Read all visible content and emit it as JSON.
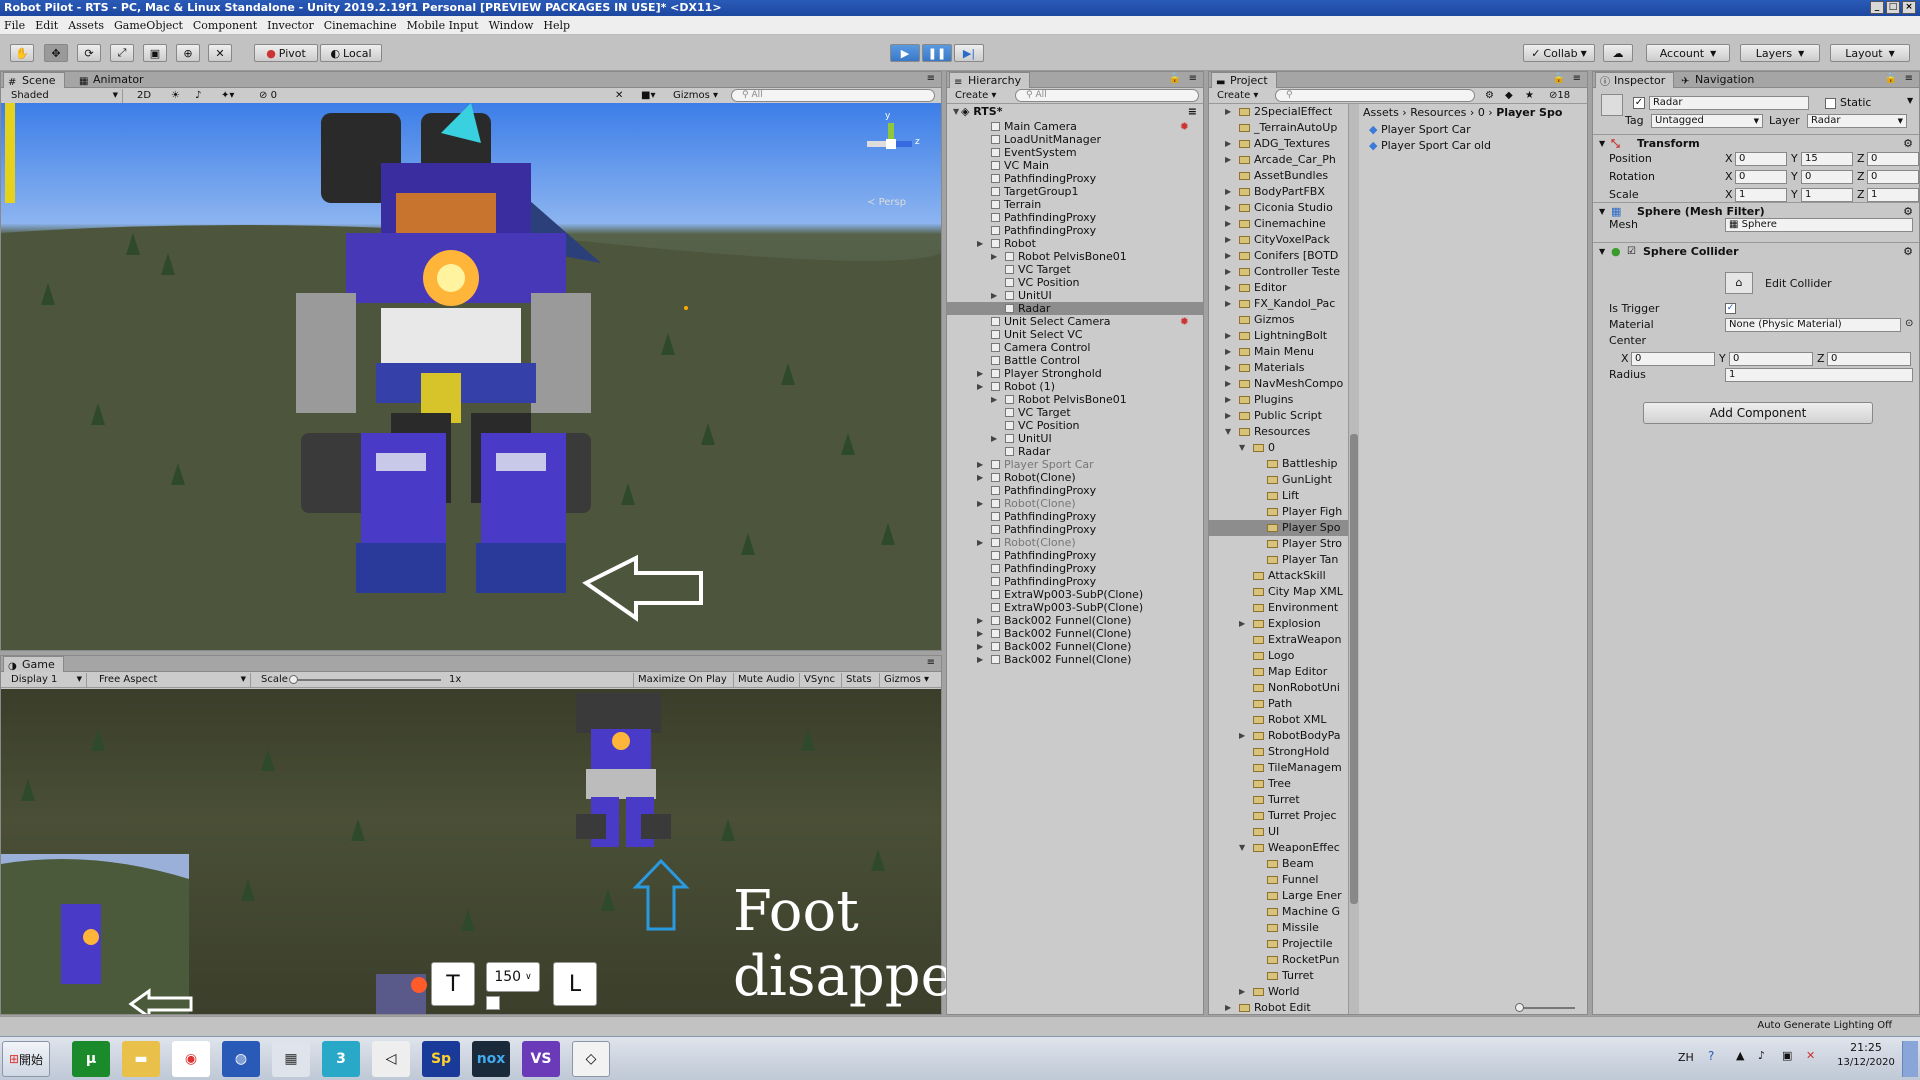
{
  "window": {
    "title": "Robot Pilot - RTS - PC, Mac & Linux Standalone - Unity 2019.2.19f1 Personal [PREVIEW PACKAGES IN USE]* <DX11>"
  },
  "menu": [
    "File",
    "Edit",
    "Assets",
    "GameObject",
    "Component",
    "Invector",
    "Cinemachine",
    "Mobile Input",
    "Window",
    "Help"
  ],
  "toolbar": {
    "pivot": "Pivot",
    "local": "Local",
    "collab": "Collab",
    "account": "Account",
    "layers": "Layers",
    "layout": "Layout"
  },
  "scene": {
    "tab_scene": "Scene",
    "tab_animator": "Animator",
    "shaded": "Shaded",
    "mode2d": "2D",
    "gizmos": "Gizmos",
    "search": "All",
    "fx_count": "0",
    "persp": "Persp",
    "axis_y": "y",
    "axis_z": "z"
  },
  "game": {
    "tab": "Game",
    "display": "Display 1",
    "aspect": "Free Aspect",
    "scale_label": "Scale",
    "scale_value": "1x",
    "maximize": "Maximize On Play",
    "mute": "Mute Audio",
    "vsync": "VSync",
    "stats": "Stats",
    "gizmos": "Gizmos",
    "btn_t": "T",
    "btn_l": "L",
    "dropdown": "150",
    "annotation": "Foot disappear?"
  },
  "hierarchy": {
    "tab": "Hierarchy",
    "create": "Create",
    "search": "All",
    "root": "RTS*",
    "items": [
      {
        "label": "Main Camera",
        "depth": 1,
        "arrow": false,
        "sel": false,
        "gray": false
      },
      {
        "label": "LoadUnitManager",
        "depth": 1,
        "arrow": false,
        "sel": false,
        "gray": false
      },
      {
        "label": "EventSystem",
        "depth": 1,
        "arrow": false,
        "sel": false,
        "gray": false
      },
      {
        "label": "VC Main",
        "depth": 1,
        "arrow": false,
        "sel": false,
        "gray": false
      },
      {
        "label": "PathfindingProxy",
        "depth": 1,
        "arrow": false,
        "sel": false,
        "gray": false
      },
      {
        "label": "TargetGroup1",
        "depth": 1,
        "arrow": false,
        "sel": false,
        "gray": false
      },
      {
        "label": "Terrain",
        "depth": 1,
        "arrow": false,
        "sel": false,
        "gray": false
      },
      {
        "label": "PathfindingProxy",
        "depth": 1,
        "arrow": false,
        "sel": false,
        "gray": false
      },
      {
        "label": "PathfindingProxy",
        "depth": 1,
        "arrow": false,
        "sel": false,
        "gray": false
      },
      {
        "label": "Robot",
        "depth": 1,
        "arrow": true,
        "sel": false,
        "gray": false
      },
      {
        "label": "Robot PelvisBone01",
        "depth": 2,
        "arrow": true,
        "sel": false,
        "gray": false
      },
      {
        "label": "VC Target",
        "depth": 2,
        "arrow": false,
        "sel": false,
        "gray": false
      },
      {
        "label": "VC Position",
        "depth": 2,
        "arrow": false,
        "sel": false,
        "gray": false
      },
      {
        "label": "UnitUI",
        "depth": 2,
        "arrow": true,
        "sel": false,
        "gray": false
      },
      {
        "label": "Radar",
        "depth": 2,
        "arrow": false,
        "sel": true,
        "gray": false
      },
      {
        "label": "Unit Select Camera",
        "depth": 1,
        "arrow": false,
        "sel": false,
        "gray": false
      },
      {
        "label": "Unit Select VC",
        "depth": 1,
        "arrow": false,
        "sel": false,
        "gray": false
      },
      {
        "label": "Camera Control",
        "depth": 1,
        "arrow": false,
        "sel": false,
        "gray": false
      },
      {
        "label": "Battle Control",
        "depth": 1,
        "arrow": false,
        "sel": false,
        "gray": false
      },
      {
        "label": "Player Stronghold",
        "depth": 1,
        "arrow": true,
        "sel": false,
        "gray": false
      },
      {
        "label": "Robot (1)",
        "depth": 1,
        "arrow": true,
        "sel": false,
        "gray": false
      },
      {
        "label": "Robot PelvisBone01",
        "depth": 2,
        "arrow": true,
        "sel": false,
        "gray": false
      },
      {
        "label": "VC Target",
        "depth": 2,
        "arrow": false,
        "sel": false,
        "gray": false
      },
      {
        "label": "VC Position",
        "depth": 2,
        "arrow": false,
        "sel": false,
        "gray": false
      },
      {
        "label": "UnitUI",
        "depth": 2,
        "arrow": true,
        "sel": false,
        "gray": false
      },
      {
        "label": "Radar",
        "depth": 2,
        "arrow": false,
        "sel": false,
        "gray": false
      },
      {
        "label": "Player Sport Car",
        "depth": 1,
        "arrow": true,
        "sel": false,
        "gray": true
      },
      {
        "label": "Robot(Clone)",
        "depth": 1,
        "arrow": true,
        "sel": false,
        "gray": false
      },
      {
        "label": "PathfindingProxy",
        "depth": 1,
        "arrow": false,
        "sel": false,
        "gray": false
      },
      {
        "label": "Robot(Clone)",
        "depth": 1,
        "arrow": true,
        "sel": false,
        "gray": true
      },
      {
        "label": "PathfindingProxy",
        "depth": 1,
        "arrow": false,
        "sel": false,
        "gray": false
      },
      {
        "label": "PathfindingProxy",
        "depth": 1,
        "arrow": false,
        "sel": false,
        "gray": false
      },
      {
        "label": "Robot(Clone)",
        "depth": 1,
        "arrow": true,
        "sel": false,
        "gray": true
      },
      {
        "label": "PathfindingProxy",
        "depth": 1,
        "arrow": false,
        "sel": false,
        "gray": false
      },
      {
        "label": "PathfindingProxy",
        "depth": 1,
        "arrow": false,
        "sel": false,
        "gray": false
      },
      {
        "label": "PathfindingProxy",
        "depth": 1,
        "arrow": false,
        "sel": false,
        "gray": false
      },
      {
        "label": "ExtraWp003-SubP(Clone)",
        "depth": 1,
        "arrow": false,
        "sel": false,
        "gray": false
      },
      {
        "label": "ExtraWp003-SubP(Clone)",
        "depth": 1,
        "arrow": false,
        "sel": false,
        "gray": false
      },
      {
        "label": "Back002 Funnel(Clone)",
        "depth": 1,
        "arrow": true,
        "sel": false,
        "gray": false
      },
      {
        "label": "Back002 Funnel(Clone)",
        "depth": 1,
        "arrow": true,
        "sel": false,
        "gray": false
      },
      {
        "label": "Back002 Funnel(Clone)",
        "depth": 1,
        "arrow": true,
        "sel": false,
        "gray": false
      },
      {
        "label": "Back002 Funnel(Clone)",
        "depth": 1,
        "arrow": true,
        "sel": false,
        "gray": false
      }
    ]
  },
  "project": {
    "tab": "Project",
    "create": "Create",
    "count": "18",
    "breadcrumb": [
      "Assets",
      "Resources",
      "0",
      "Player Spo"
    ],
    "files": [
      "Player Sport Car",
      "Player Sport Car old"
    ],
    "folders": [
      {
        "label": "2SpecialEffect",
        "d": 0,
        "arrow": true
      },
      {
        "label": "_TerrainAutoUp",
        "d": 0,
        "arrow": false
      },
      {
        "label": "ADG_Textures",
        "d": 0,
        "arrow": true
      },
      {
        "label": "Arcade_Car_Ph",
        "d": 0,
        "arrow": true
      },
      {
        "label": "AssetBundles",
        "d": 0,
        "arrow": false
      },
      {
        "label": "BodyPartFBX",
        "d": 0,
        "arrow": true
      },
      {
        "label": "Ciconia Studio",
        "d": 0,
        "arrow": true
      },
      {
        "label": "Cinemachine",
        "d": 0,
        "arrow": true
      },
      {
        "label": "CityVoxelPack",
        "d": 0,
        "arrow": true
      },
      {
        "label": "Conifers [BOTD",
        "d": 0,
        "arrow": true
      },
      {
        "label": "Controller Teste",
        "d": 0,
        "arrow": true
      },
      {
        "label": "Editor",
        "d": 0,
        "arrow": true
      },
      {
        "label": "FX_Kandol_Pac",
        "d": 0,
        "arrow": true
      },
      {
        "label": "Gizmos",
        "d": 0,
        "arrow": false
      },
      {
        "label": "LightningBolt",
        "d": 0,
        "arrow": true
      },
      {
        "label": "Main Menu",
        "d": 0,
        "arrow": true
      },
      {
        "label": "Materials",
        "d": 0,
        "arrow": true
      },
      {
        "label": "NavMeshCompo",
        "d": 0,
        "arrow": true
      },
      {
        "label": "Plugins",
        "d": 0,
        "arrow": true
      },
      {
        "label": "Public Script",
        "d": 0,
        "arrow": true
      },
      {
        "label": "Resources",
        "d": 0,
        "arrow": true
      },
      {
        "label": "0",
        "d": 1,
        "arrow": true
      },
      {
        "label": "Battleship",
        "d": 2,
        "arrow": false
      },
      {
        "label": "GunLight",
        "d": 2,
        "arrow": false
      },
      {
        "label": "Lift",
        "d": 2,
        "arrow": false
      },
      {
        "label": "Player Figh",
        "d": 2,
        "arrow": false
      },
      {
        "label": "Player Spo",
        "d": 2,
        "arrow": false,
        "sel": true
      },
      {
        "label": "Player Stro",
        "d": 2,
        "arrow": false
      },
      {
        "label": "Player Tan",
        "d": 2,
        "arrow": false
      },
      {
        "label": "AttackSkill",
        "d": 1,
        "arrow": false
      },
      {
        "label": "City Map XML",
        "d": 1,
        "arrow": false
      },
      {
        "label": "Environment",
        "d": 1,
        "arrow": false
      },
      {
        "label": "Explosion",
        "d": 1,
        "arrow": true
      },
      {
        "label": "ExtraWeapon",
        "d": 1,
        "arrow": false
      },
      {
        "label": "Logo",
        "d": 1,
        "arrow": false
      },
      {
        "label": "Map Editor",
        "d": 1,
        "arrow": false
      },
      {
        "label": "NonRobotUni",
        "d": 1,
        "arrow": false
      },
      {
        "label": "Path",
        "d": 1,
        "arrow": false
      },
      {
        "label": "Robot XML",
        "d": 1,
        "arrow": false
      },
      {
        "label": "RobotBodyPa",
        "d": 1,
        "arrow": true
      },
      {
        "label": "StrongHold",
        "d": 1,
        "arrow": false
      },
      {
        "label": "TileManagem",
        "d": 1,
        "arrow": false
      },
      {
        "label": "Tree",
        "d": 1,
        "arrow": false
      },
      {
        "label": "Turret",
        "d": 1,
        "arrow": false
      },
      {
        "label": "Turret Projec",
        "d": 1,
        "arrow": false
      },
      {
        "label": "UI",
        "d": 1,
        "arrow": false
      },
      {
        "label": "WeaponEffec",
        "d": 1,
        "arrow": true
      },
      {
        "label": "Beam",
        "d": 2,
        "arrow": false
      },
      {
        "label": "Funnel",
        "d": 2,
        "arrow": false
      },
      {
        "label": "Large Ener",
        "d": 2,
        "arrow": false
      },
      {
        "label": "Machine G",
        "d": 2,
        "arrow": false
      },
      {
        "label": "Missile",
        "d": 2,
        "arrow": false
      },
      {
        "label": "Projectile",
        "d": 2,
        "arrow": false
      },
      {
        "label": "RocketPun",
        "d": 2,
        "arrow": false
      },
      {
        "label": "Turret",
        "d": 2,
        "arrow": false
      },
      {
        "label": "World",
        "d": 1,
        "arrow": true
      },
      {
        "label": "Robot Edit",
        "d": 0,
        "arrow": true
      }
    ]
  },
  "inspector": {
    "tab": "Inspector",
    "tab_nav": "Navigation",
    "name": "Radar",
    "static": "Static",
    "tag_label": "Tag",
    "tag": "Untagged",
    "layer_label": "Layer",
    "layer": "Radar",
    "transform": "Transform",
    "position_label": "Position",
    "rotation_label": "Rotation",
    "scale_label": "Scale",
    "position": [
      "0",
      "15",
      "0"
    ],
    "rotation": [
      "0",
      "0",
      "0"
    ],
    "scale": [
      "1",
      "1",
      "1"
    ],
    "mesh_filter": "Sphere (Mesh Filter)",
    "mesh_label": "Mesh",
    "mesh": "Sphere",
    "collider": "Sphere Collider",
    "edit_collider": "Edit Collider",
    "trigger_label": "Is Trigger",
    "material_label": "Material",
    "material": "None (Physic Material)",
    "center_label": "Center",
    "center": [
      "0",
      "0",
      "0"
    ],
    "radius_label": "Radius",
    "radius": "1",
    "add_component": "Add Component"
  },
  "status": {
    "right": "Auto Generate Lighting Off"
  },
  "taskbar": {
    "start": "開始",
    "lang": "ZH",
    "time": "21:25",
    "date": "13/12/2020"
  }
}
